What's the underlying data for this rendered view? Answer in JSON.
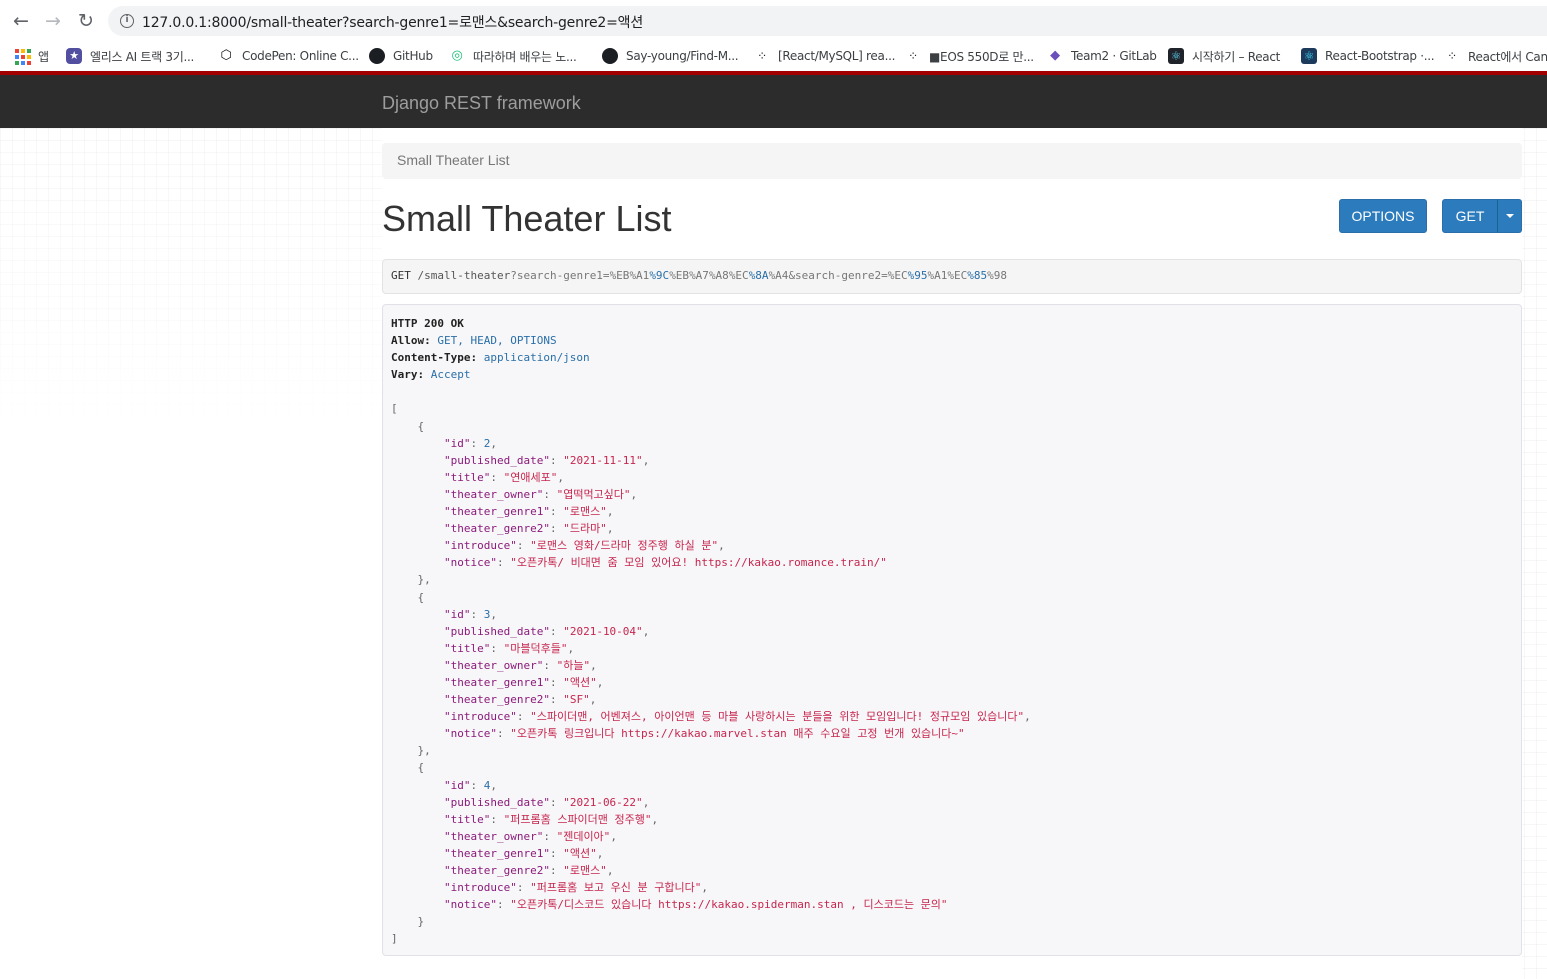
{
  "browser": {
    "url": "127.0.0.1:8000/small-theater?search-genre1=로맨스&search-genre2=액션",
    "bookmarks": [
      {
        "label": "앱",
        "icon": "apps-grid-icon"
      },
      {
        "label": "엘리스 AI 트랙 3기...",
        "icon": "elice-icon"
      },
      {
        "label": "CodePen: Online C...",
        "icon": "codepen-icon"
      },
      {
        "label": "GitHub",
        "icon": "github-icon"
      },
      {
        "label": "따라하며 배우는 노...",
        "icon": "inflearn-icon"
      },
      {
        "label": "Say-young/Find-M...",
        "icon": "github-icon"
      },
      {
        "label": "[React/MySQL] rea...",
        "icon": "velog-icon"
      },
      {
        "label": "■EOS 550D로 만...",
        "icon": "velog-icon"
      },
      {
        "label": "Team2 · GitLab",
        "icon": "gitlab-icon"
      },
      {
        "label": "시작하기 – React",
        "icon": "react-icon"
      },
      {
        "label": "React-Bootstrap ·...",
        "icon": "react-bootstrap-icon"
      },
      {
        "label": "React에서 Can",
        "icon": "velog-icon"
      }
    ]
  },
  "navbar": {
    "brand": "Django REST framework"
  },
  "breadcrumb": "Small Theater List",
  "page": {
    "title": "Small Theater List",
    "options_label": "OPTIONS",
    "get_label": "GET"
  },
  "request": {
    "method": "GET",
    "path": "/small-theater",
    "query_segments": [
      {
        "text": "?search-genre1=",
        "kind": "q"
      },
      {
        "text": "%EB",
        "kind": "q"
      },
      {
        "text": "%A1",
        "kind": "q"
      },
      {
        "text": "%9C",
        "kind": "v"
      },
      {
        "text": "%EB",
        "kind": "q"
      },
      {
        "text": "%A7",
        "kind": "q"
      },
      {
        "text": "%A8",
        "kind": "q"
      },
      {
        "text": "%EC",
        "kind": "q"
      },
      {
        "text": "%8A",
        "kind": "v"
      },
      {
        "text": "%A4",
        "kind": "q"
      },
      {
        "text": "&search-genre2=",
        "kind": "q"
      },
      {
        "text": "%EC",
        "kind": "q"
      },
      {
        "text": "%95",
        "kind": "v"
      },
      {
        "text": "%A1",
        "kind": "q"
      },
      {
        "text": "%EC",
        "kind": "q"
      },
      {
        "text": "%85",
        "kind": "v"
      },
      {
        "text": "%98",
        "kind": "q"
      }
    ]
  },
  "response": {
    "status": "HTTP 200 OK",
    "headers": [
      {
        "name": "Allow",
        "value": "GET, HEAD, OPTIONS"
      },
      {
        "name": "Content-Type",
        "value": "application/json"
      },
      {
        "name": "Vary",
        "value": "Accept"
      }
    ],
    "items": [
      {
        "id": 2,
        "published_date": "2021-11-11",
        "title": "연애세포",
        "theater_owner": "엽떡먹고싶다",
        "theater_genre1": "로맨스",
        "theater_genre2": "드라마",
        "introduce": "로맨스 영화/드라마 정주행 하실 분",
        "notice": "오픈카톡/ 비대면 줌 모임 있어요! https://kakao.romance.train/"
      },
      {
        "id": 3,
        "published_date": "2021-10-04",
        "title": "마블덕후들",
        "theater_owner": "하늘",
        "theater_genre1": "액션",
        "theater_genre2": "SF",
        "introduce": "스파이더맨, 어벤져스, 아이언맨 등 마블 사랑하시는 분들을 위한 모임입니다! 정규모임 있습니다",
        "notice": "오픈카톡 링크입니다 https://kakao.marvel.stan 매주 수요일 고정 번개 있습니다~"
      },
      {
        "id": 4,
        "published_date": "2021-06-22",
        "title": "퍼프롬홈 스파이더맨 정주행",
        "theater_owner": "젠데이아",
        "theater_genre1": "액션",
        "theater_genre2": "로맨스",
        "introduce": "퍼프롬홈 보고 우신 분 구합니다",
        "notice": "오픈카톡/디스코드 있습니다 https://kakao.spiderman.stan , 디스코드는 문의"
      }
    ]
  },
  "colors": {
    "navbar_bg": "#2c2c2c",
    "accent_red": "#a30000",
    "button_blue": "#2c7bbd"
  }
}
